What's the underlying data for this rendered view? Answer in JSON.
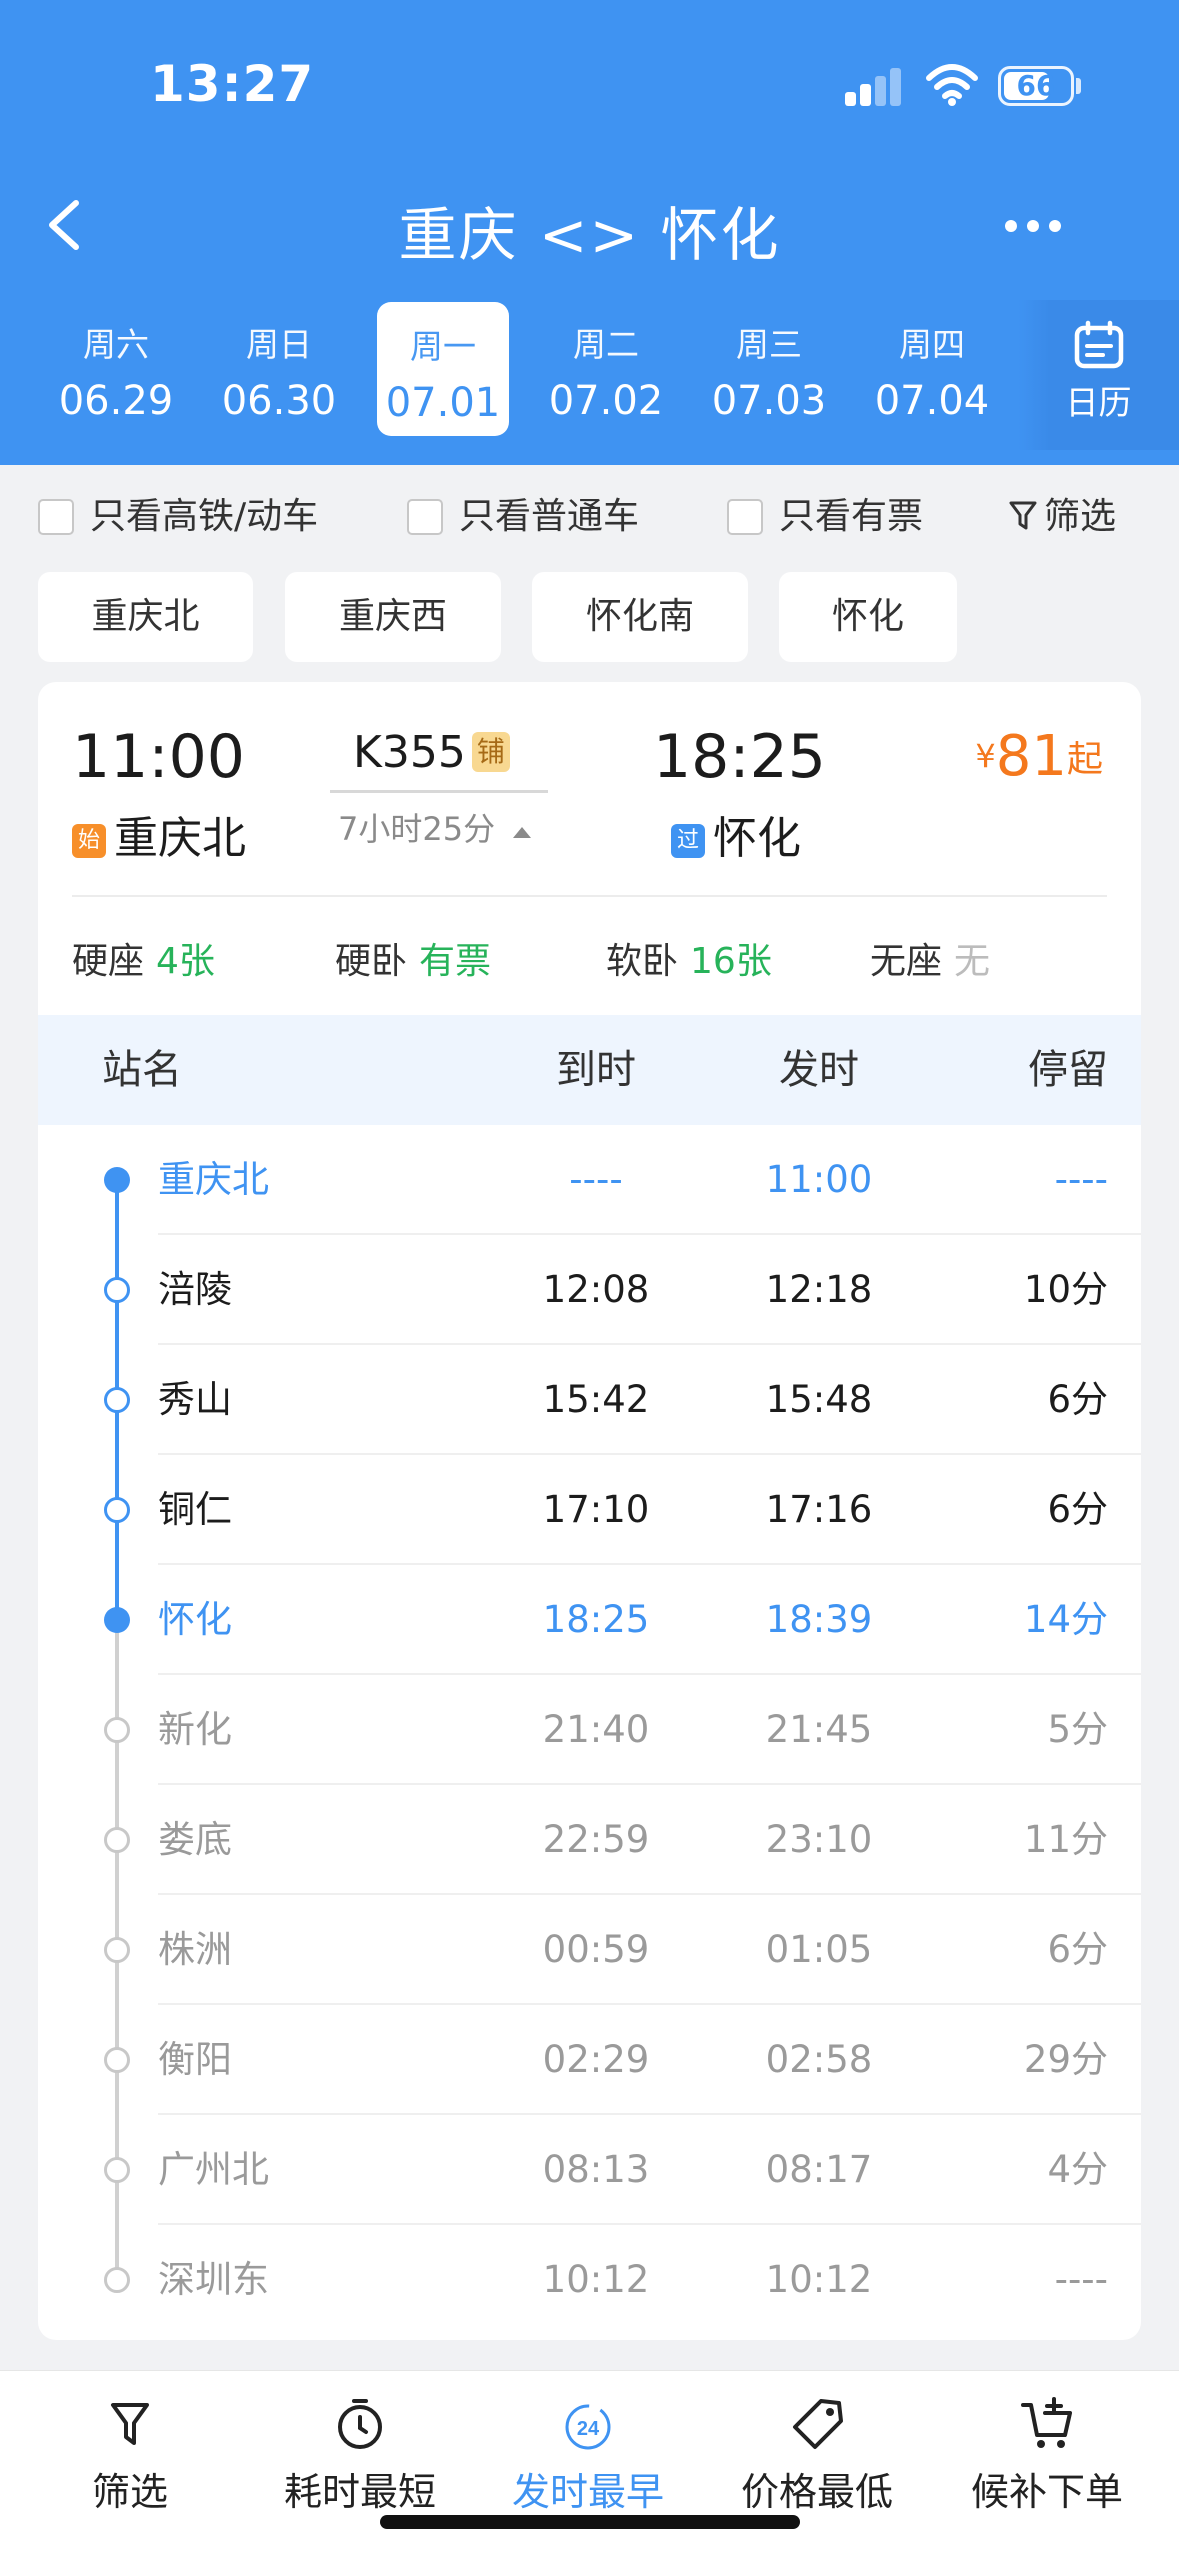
{
  "status_bar": {
    "time": "13:27",
    "battery": "66"
  },
  "header": {
    "title": "重庆 <> 怀化"
  },
  "dates": [
    {
      "weekday": "周六",
      "date": "06.29"
    },
    {
      "weekday": "周日",
      "date": "06.30"
    },
    {
      "weekday": "周一",
      "date": "07.01",
      "selected": true
    },
    {
      "weekday": "周二",
      "date": "07.02"
    },
    {
      "weekday": "周三",
      "date": "07.03"
    },
    {
      "weekday": "周四",
      "date": "07.04"
    }
  ],
  "calendar_label": "日历",
  "filters": {
    "high_speed": "只看高铁/动车",
    "regular": "只看普通车",
    "available": "只看有票",
    "filter_btn": "筛选"
  },
  "station_chips": [
    "重庆北",
    "重庆西",
    "怀化南",
    "怀化"
  ],
  "train": {
    "dep_time": "11:00",
    "dep_tag": "始",
    "dep_station": "重庆北",
    "number": "K355",
    "badge": "铺",
    "duration": "7小时25分",
    "arr_time": "18:25",
    "arr_tag": "过",
    "arr_station": "怀化",
    "price_symbol": "¥",
    "price": "81",
    "price_suffix": "起",
    "seats": [
      {
        "type": "硬座",
        "value": "4张"
      },
      {
        "type": "硬卧",
        "value": "有票"
      },
      {
        "type": "软卧",
        "value": "16张"
      },
      {
        "type": "无座",
        "value": "无"
      }
    ]
  },
  "table": {
    "headers": {
      "name": "站名",
      "arr": "到时",
      "dep": "发时",
      "stay": "停留"
    },
    "rows": [
      {
        "name": "重庆北",
        "arr": "----",
        "dep": "11:00",
        "stay": "----",
        "style": "blue"
      },
      {
        "name": "涪陵",
        "arr": "12:08",
        "dep": "12:18",
        "stay": "10分",
        "style": "dark"
      },
      {
        "name": "秀山",
        "arr": "15:42",
        "dep": "15:48",
        "stay": "6分",
        "style": "dark"
      },
      {
        "name": "铜仁",
        "arr": "17:10",
        "dep": "17:16",
        "stay": "6分",
        "style": "dark"
      },
      {
        "name": "怀化",
        "arr": "18:25",
        "dep": "18:39",
        "stay": "14分",
        "style": "blue"
      },
      {
        "name": "新化",
        "arr": "21:40",
        "dep": "21:45",
        "stay": "5分",
        "style": "gray"
      },
      {
        "name": "娄底",
        "arr": "22:59",
        "dep": "23:10",
        "stay": "11分",
        "style": "gray"
      },
      {
        "name": "株洲",
        "arr": "00:59",
        "dep": "01:05",
        "stay": "6分",
        "style": "gray"
      },
      {
        "name": "衡阳",
        "arr": "02:29",
        "dep": "02:58",
        "stay": "29分",
        "style": "gray"
      },
      {
        "name": "广州北",
        "arr": "08:13",
        "dep": "08:17",
        "stay": "4分",
        "style": "gray"
      },
      {
        "name": "深圳东",
        "arr": "10:12",
        "dep": "10:12",
        "stay": "----",
        "style": "gray"
      }
    ]
  },
  "bottom_tabs": [
    {
      "label": "筛选",
      "icon": "filter-icon"
    },
    {
      "label": "耗时最短",
      "icon": "timer-icon"
    },
    {
      "label": "发时最早",
      "icon": "clock-24-icon",
      "active": true,
      "icon_text": "24"
    },
    {
      "label": "价格最低",
      "icon": "price-tag-icon"
    },
    {
      "label": "候补下单",
      "icon": "cart-plus-icon"
    }
  ],
  "colors": {
    "brand_blue": "#3f93f2",
    "price_orange": "#f4781d",
    "available_green": "#27b35a"
  }
}
